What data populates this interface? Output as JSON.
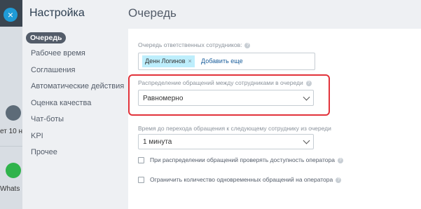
{
  "background": {
    "close_icon": "×",
    "chat_text_1": "ет 10 н",
    "chat_text_2": "Whats"
  },
  "sidebar": {
    "title": "Настройка",
    "items": [
      {
        "label": "Очередь",
        "active": true
      },
      {
        "label": "Рабочее время"
      },
      {
        "label": "Соглашения"
      },
      {
        "label": "Автоматические действия"
      },
      {
        "label": "Оценка качества"
      },
      {
        "label": "Чат-боты"
      },
      {
        "label": "KPI"
      },
      {
        "label": "Прочее"
      }
    ]
  },
  "main": {
    "title": "Очередь",
    "queue": {
      "label": "Очередь ответственных сотрудников:",
      "tag": "Денн Логинов",
      "tag_remove": "×",
      "add_link": "Добавить еще"
    },
    "distribution": {
      "label": "Распределение обращений между сотрудниками в очереди",
      "value": "Равномерно"
    },
    "transfer_time": {
      "label": "Время до перехода обращения к следующему сотруднику из очереди",
      "value": "1 минута"
    },
    "checkboxes": [
      {
        "label": "При распределении обращений проверять доступность оператора",
        "checked": false
      },
      {
        "label": "Ограничить количество одновременных обращений на оператора",
        "checked": false
      }
    ]
  },
  "colors": {
    "accent": "#1f9bd7",
    "highlight": "#e2333b",
    "tag_bg": "#bdeefc",
    "link": "#1a5e9c"
  }
}
